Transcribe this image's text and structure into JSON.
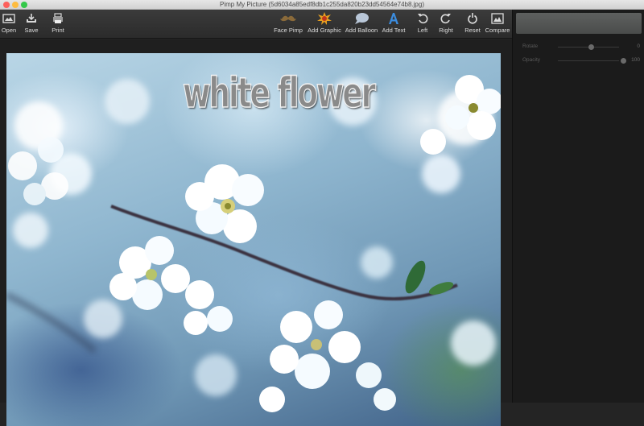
{
  "window": {
    "title": "Pimp My Picture (5d6034a85edf8db1c255da820b23dd54564e74b8.jpg)"
  },
  "toolbar": {
    "left_items": [
      {
        "label": "Open",
        "icon": "open-icon"
      },
      {
        "label": "Save",
        "icon": "save-icon"
      },
      {
        "label": "Print",
        "icon": "print-icon"
      }
    ],
    "right_items": [
      {
        "label": "Face Pimp",
        "icon": "mustache-icon"
      },
      {
        "label": "Add Graphic",
        "icon": "starburst-icon"
      },
      {
        "label": "Add Balloon",
        "icon": "speech-balloon-icon"
      },
      {
        "label": "Add Text",
        "icon": "text-a-icon"
      },
      {
        "label": "Left",
        "icon": "rotate-left-icon"
      },
      {
        "label": "Right",
        "icon": "rotate-right-icon"
      },
      {
        "label": "Reset",
        "icon": "reset-icon"
      },
      {
        "label": "Compare",
        "icon": "compare-icon"
      }
    ]
  },
  "properties": {
    "rotate": {
      "label": "Rotate",
      "value": "0"
    },
    "opacity": {
      "label": "Opacity",
      "value": "100"
    }
  },
  "canvas": {
    "overlay_text": "white flower"
  },
  "colors": {
    "toolbar_bg": "#2e2e2e",
    "panel_bg": "#1b1b1b",
    "label_text": "#dcdcdc",
    "accent_blue": "#3b8de0",
    "starburst": "#e8a020"
  }
}
